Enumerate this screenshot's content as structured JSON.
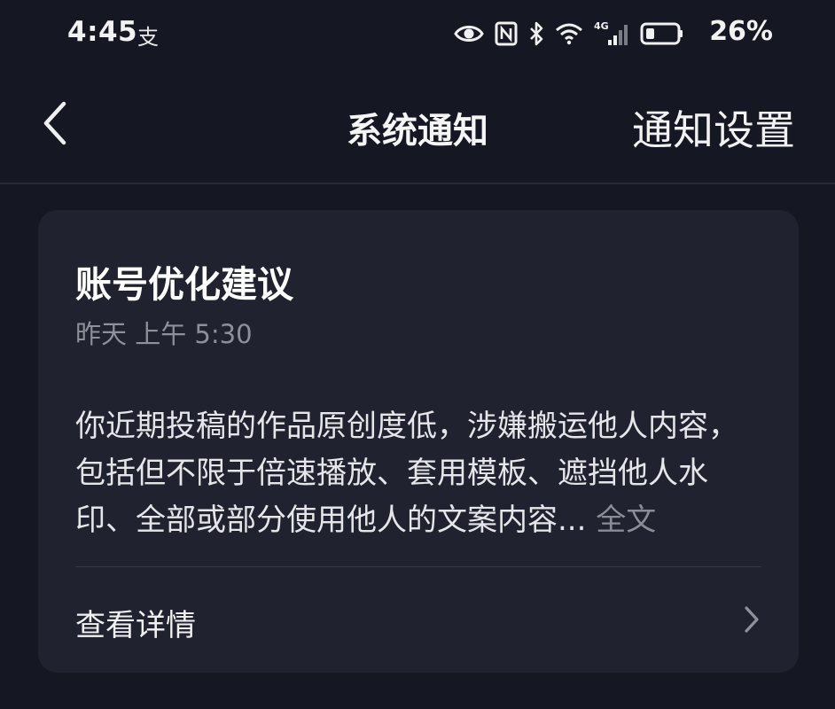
{
  "status_bar": {
    "time": "4:45",
    "alipay_icon_char": "支",
    "battery_percent": "26%",
    "icons": [
      "eye-icon",
      "nfc-icon",
      "bluetooth-icon",
      "wifi-icon",
      "cellular-4g-icon",
      "battery-icon"
    ],
    "network_label": "4G"
  },
  "header": {
    "title": "系统通知",
    "action_label": "通知设置",
    "back_icon": "chevron-left-icon"
  },
  "notification": {
    "title": "账号优化建议",
    "timestamp": "昨天 上午 5:30",
    "body": "你近期投稿的作品原创度低，涉嫌搬运他人内容，包括但不限于倍速播放、套用模板、遮挡他人水印、全部或部分使用他人的文案内容...",
    "expand_label": "全文",
    "details_label": "查看详情",
    "details_icon": "chevron-right-icon"
  },
  "colors": {
    "background": "#151722",
    "card": "#20232f",
    "secondary_text": "#8e909a"
  }
}
